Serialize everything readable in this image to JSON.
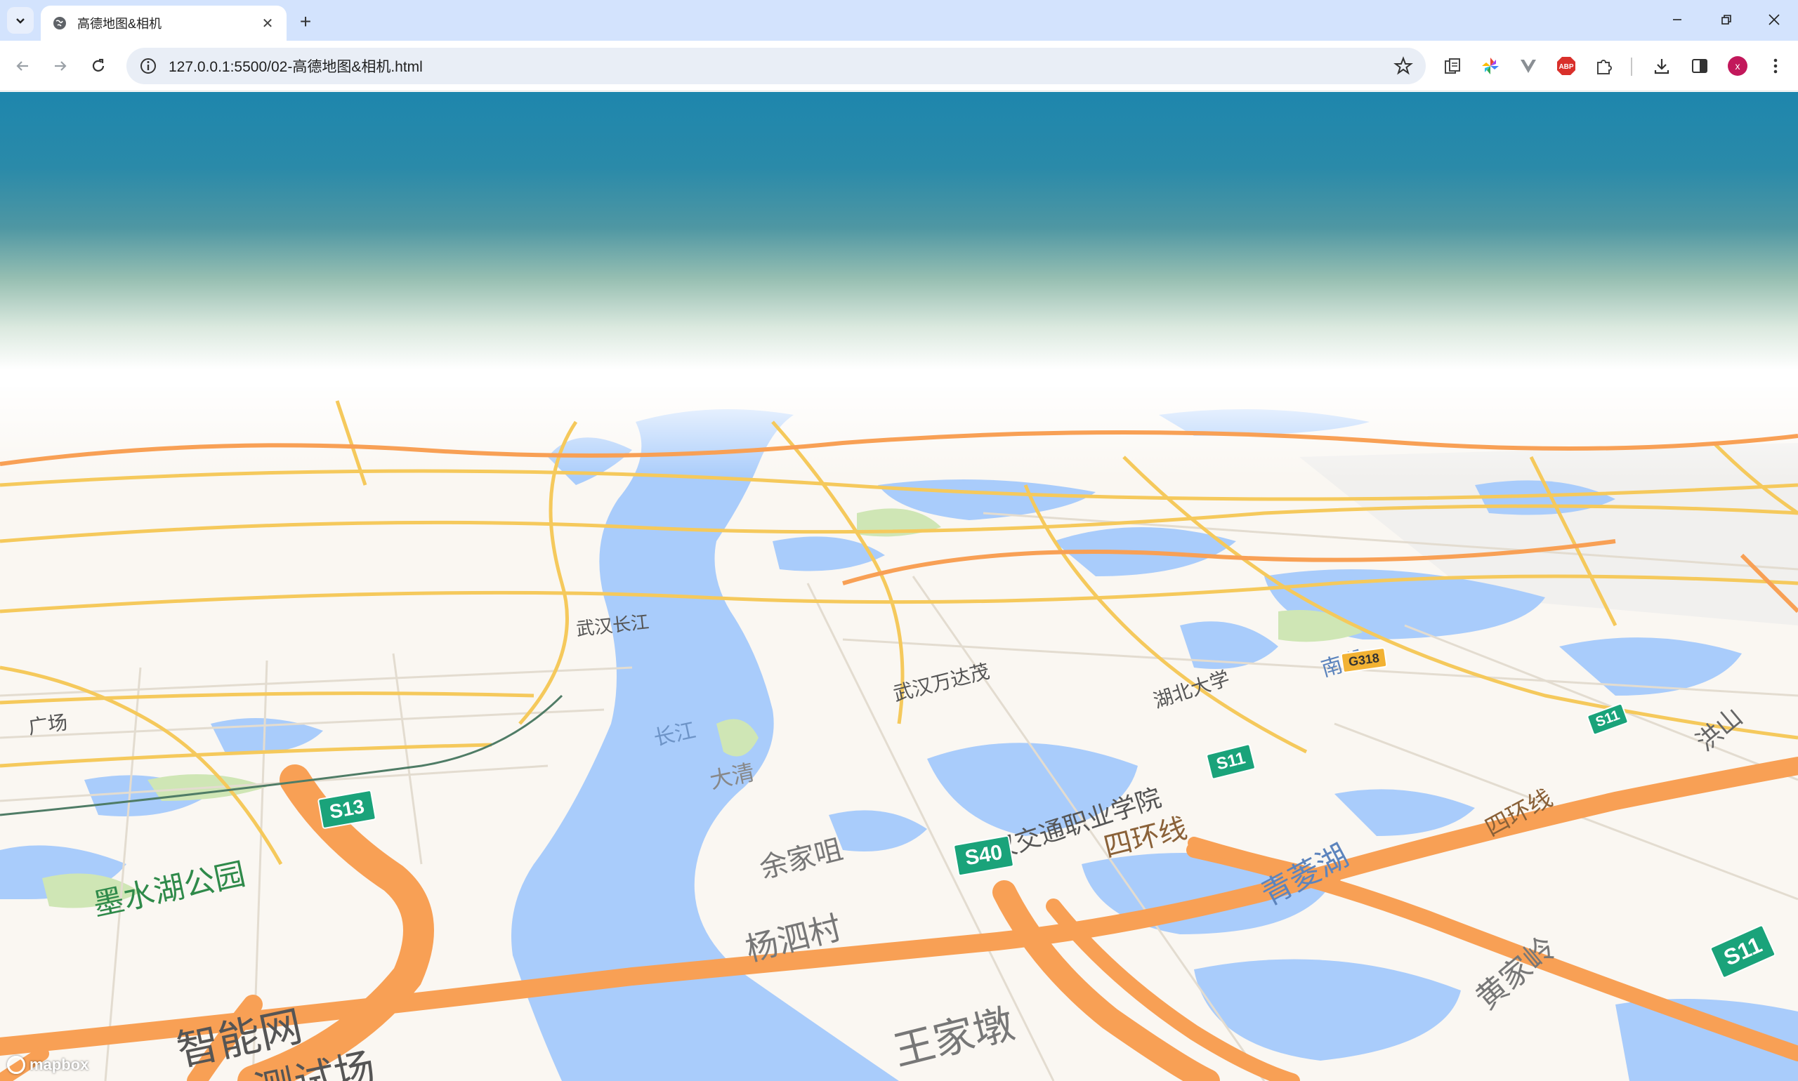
{
  "browser": {
    "tab_title": "高德地图&相机",
    "url": "127.0.0.1:5500/02-高德地图&相机.html",
    "profile_initial": "x",
    "ext_abp": "ABP"
  },
  "map": {
    "attribution": "mapbox",
    "labels": {
      "chang_jiang": "长江",
      "da_qing": "大清",
      "yu_jia_ju": "余家咀",
      "yang_si_cun": "杨泗村",
      "wang_jia_dun": "王家墩",
      "si_huan_xian": "四环线",
      "qing_ling_hu": "青菱湖",
      "lan_jia_ling": "黄家岭",
      "si_huan_xian_2": "四环线",
      "mo_shui_hu_park": "墨水湖公园",
      "zhi_neng_wang": "智能网",
      "ce_shi_chang": "测试场",
      "wuhan_jiaotong": "武汉交通职业学院",
      "wuhan_wanda": "武汉万达茂",
      "hubei_univ": "湖北大学",
      "hongshan": "洪山",
      "wuhan_yangtze": "武汉长江",
      "guangchang": "广场",
      "nan_hu": "南湖"
    },
    "shields": {
      "s13": "S13",
      "s40": "S40",
      "s11a": "S11",
      "s11b": "S11",
      "s11c": "S11",
      "g318": "G318"
    },
    "colors": {
      "sky_top": "#1e86ad",
      "land": "#faf7f2",
      "water": "#a9ccfb",
      "park": "#cfe6b5",
      "highway": "#f8a055",
      "arterial": "#f5c95c",
      "shield": "#1aa37a"
    }
  }
}
